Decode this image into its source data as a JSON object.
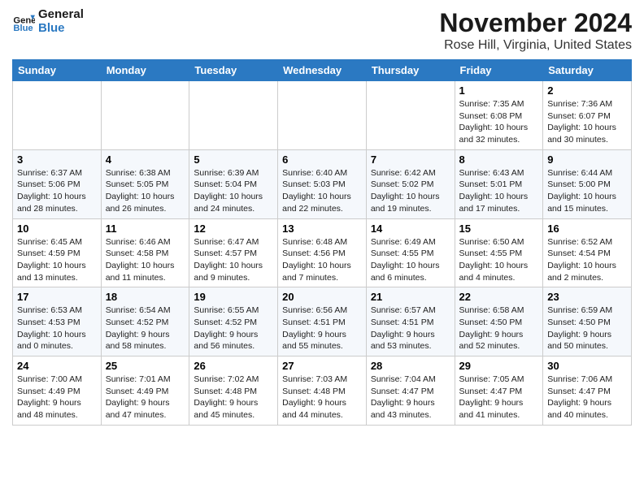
{
  "header": {
    "logo_line1": "General",
    "logo_line2": "Blue",
    "month_year": "November 2024",
    "location": "Rose Hill, Virginia, United States"
  },
  "weekdays": [
    "Sunday",
    "Monday",
    "Tuesday",
    "Wednesday",
    "Thursday",
    "Friday",
    "Saturday"
  ],
  "weeks": [
    [
      {
        "day": "",
        "info": ""
      },
      {
        "day": "",
        "info": ""
      },
      {
        "day": "",
        "info": ""
      },
      {
        "day": "",
        "info": ""
      },
      {
        "day": "",
        "info": ""
      },
      {
        "day": "1",
        "info": "Sunrise: 7:35 AM\nSunset: 6:08 PM\nDaylight: 10 hours\nand 32 minutes."
      },
      {
        "day": "2",
        "info": "Sunrise: 7:36 AM\nSunset: 6:07 PM\nDaylight: 10 hours\nand 30 minutes."
      }
    ],
    [
      {
        "day": "3",
        "info": "Sunrise: 6:37 AM\nSunset: 5:06 PM\nDaylight: 10 hours\nand 28 minutes."
      },
      {
        "day": "4",
        "info": "Sunrise: 6:38 AM\nSunset: 5:05 PM\nDaylight: 10 hours\nand 26 minutes."
      },
      {
        "day": "5",
        "info": "Sunrise: 6:39 AM\nSunset: 5:04 PM\nDaylight: 10 hours\nand 24 minutes."
      },
      {
        "day": "6",
        "info": "Sunrise: 6:40 AM\nSunset: 5:03 PM\nDaylight: 10 hours\nand 22 minutes."
      },
      {
        "day": "7",
        "info": "Sunrise: 6:42 AM\nSunset: 5:02 PM\nDaylight: 10 hours\nand 19 minutes."
      },
      {
        "day": "8",
        "info": "Sunrise: 6:43 AM\nSunset: 5:01 PM\nDaylight: 10 hours\nand 17 minutes."
      },
      {
        "day": "9",
        "info": "Sunrise: 6:44 AM\nSunset: 5:00 PM\nDaylight: 10 hours\nand 15 minutes."
      }
    ],
    [
      {
        "day": "10",
        "info": "Sunrise: 6:45 AM\nSunset: 4:59 PM\nDaylight: 10 hours\nand 13 minutes."
      },
      {
        "day": "11",
        "info": "Sunrise: 6:46 AM\nSunset: 4:58 PM\nDaylight: 10 hours\nand 11 minutes."
      },
      {
        "day": "12",
        "info": "Sunrise: 6:47 AM\nSunset: 4:57 PM\nDaylight: 10 hours\nand 9 minutes."
      },
      {
        "day": "13",
        "info": "Sunrise: 6:48 AM\nSunset: 4:56 PM\nDaylight: 10 hours\nand 7 minutes."
      },
      {
        "day": "14",
        "info": "Sunrise: 6:49 AM\nSunset: 4:55 PM\nDaylight: 10 hours\nand 6 minutes."
      },
      {
        "day": "15",
        "info": "Sunrise: 6:50 AM\nSunset: 4:55 PM\nDaylight: 10 hours\nand 4 minutes."
      },
      {
        "day": "16",
        "info": "Sunrise: 6:52 AM\nSunset: 4:54 PM\nDaylight: 10 hours\nand 2 minutes."
      }
    ],
    [
      {
        "day": "17",
        "info": "Sunrise: 6:53 AM\nSunset: 4:53 PM\nDaylight: 10 hours\nand 0 minutes."
      },
      {
        "day": "18",
        "info": "Sunrise: 6:54 AM\nSunset: 4:52 PM\nDaylight: 9 hours\nand 58 minutes."
      },
      {
        "day": "19",
        "info": "Sunrise: 6:55 AM\nSunset: 4:52 PM\nDaylight: 9 hours\nand 56 minutes."
      },
      {
        "day": "20",
        "info": "Sunrise: 6:56 AM\nSunset: 4:51 PM\nDaylight: 9 hours\nand 55 minutes."
      },
      {
        "day": "21",
        "info": "Sunrise: 6:57 AM\nSunset: 4:51 PM\nDaylight: 9 hours\nand 53 minutes."
      },
      {
        "day": "22",
        "info": "Sunrise: 6:58 AM\nSunset: 4:50 PM\nDaylight: 9 hours\nand 52 minutes."
      },
      {
        "day": "23",
        "info": "Sunrise: 6:59 AM\nSunset: 4:50 PM\nDaylight: 9 hours\nand 50 minutes."
      }
    ],
    [
      {
        "day": "24",
        "info": "Sunrise: 7:00 AM\nSunset: 4:49 PM\nDaylight: 9 hours\nand 48 minutes."
      },
      {
        "day": "25",
        "info": "Sunrise: 7:01 AM\nSunset: 4:49 PM\nDaylight: 9 hours\nand 47 minutes."
      },
      {
        "day": "26",
        "info": "Sunrise: 7:02 AM\nSunset: 4:48 PM\nDaylight: 9 hours\nand 45 minutes."
      },
      {
        "day": "27",
        "info": "Sunrise: 7:03 AM\nSunset: 4:48 PM\nDaylight: 9 hours\nand 44 minutes."
      },
      {
        "day": "28",
        "info": "Sunrise: 7:04 AM\nSunset: 4:47 PM\nDaylight: 9 hours\nand 43 minutes."
      },
      {
        "day": "29",
        "info": "Sunrise: 7:05 AM\nSunset: 4:47 PM\nDaylight: 9 hours\nand 41 minutes."
      },
      {
        "day": "30",
        "info": "Sunrise: 7:06 AM\nSunset: 4:47 PM\nDaylight: 9 hours\nand 40 minutes."
      }
    ]
  ]
}
